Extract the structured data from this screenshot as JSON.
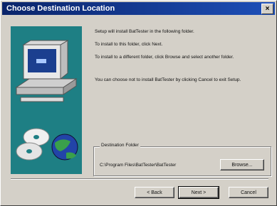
{
  "window": {
    "title": "Choose Destination Location",
    "close_label": "×"
  },
  "messages": [
    "Setup will install BatTester in the following folder.",
    "To install to this folder, click Next.",
    "To install to a different folder, click Browse and select another folder.",
    "You can choose not to install BatTester by clicking Cancel to exit Setup."
  ],
  "destination": {
    "label": "Destination Folder",
    "path": "C:\\Program Files\\BatTester\\BatTester",
    "browse_label": "Browse..."
  },
  "buttons": {
    "back": "< Back",
    "next": "Next >",
    "cancel": "Cancel"
  },
  "colors": {
    "titlebar_start": "#0a246a",
    "titlebar_end": "#1e4fb8",
    "dialog_bg": "#d4d0c8",
    "art_bg": "#1e7f84"
  }
}
